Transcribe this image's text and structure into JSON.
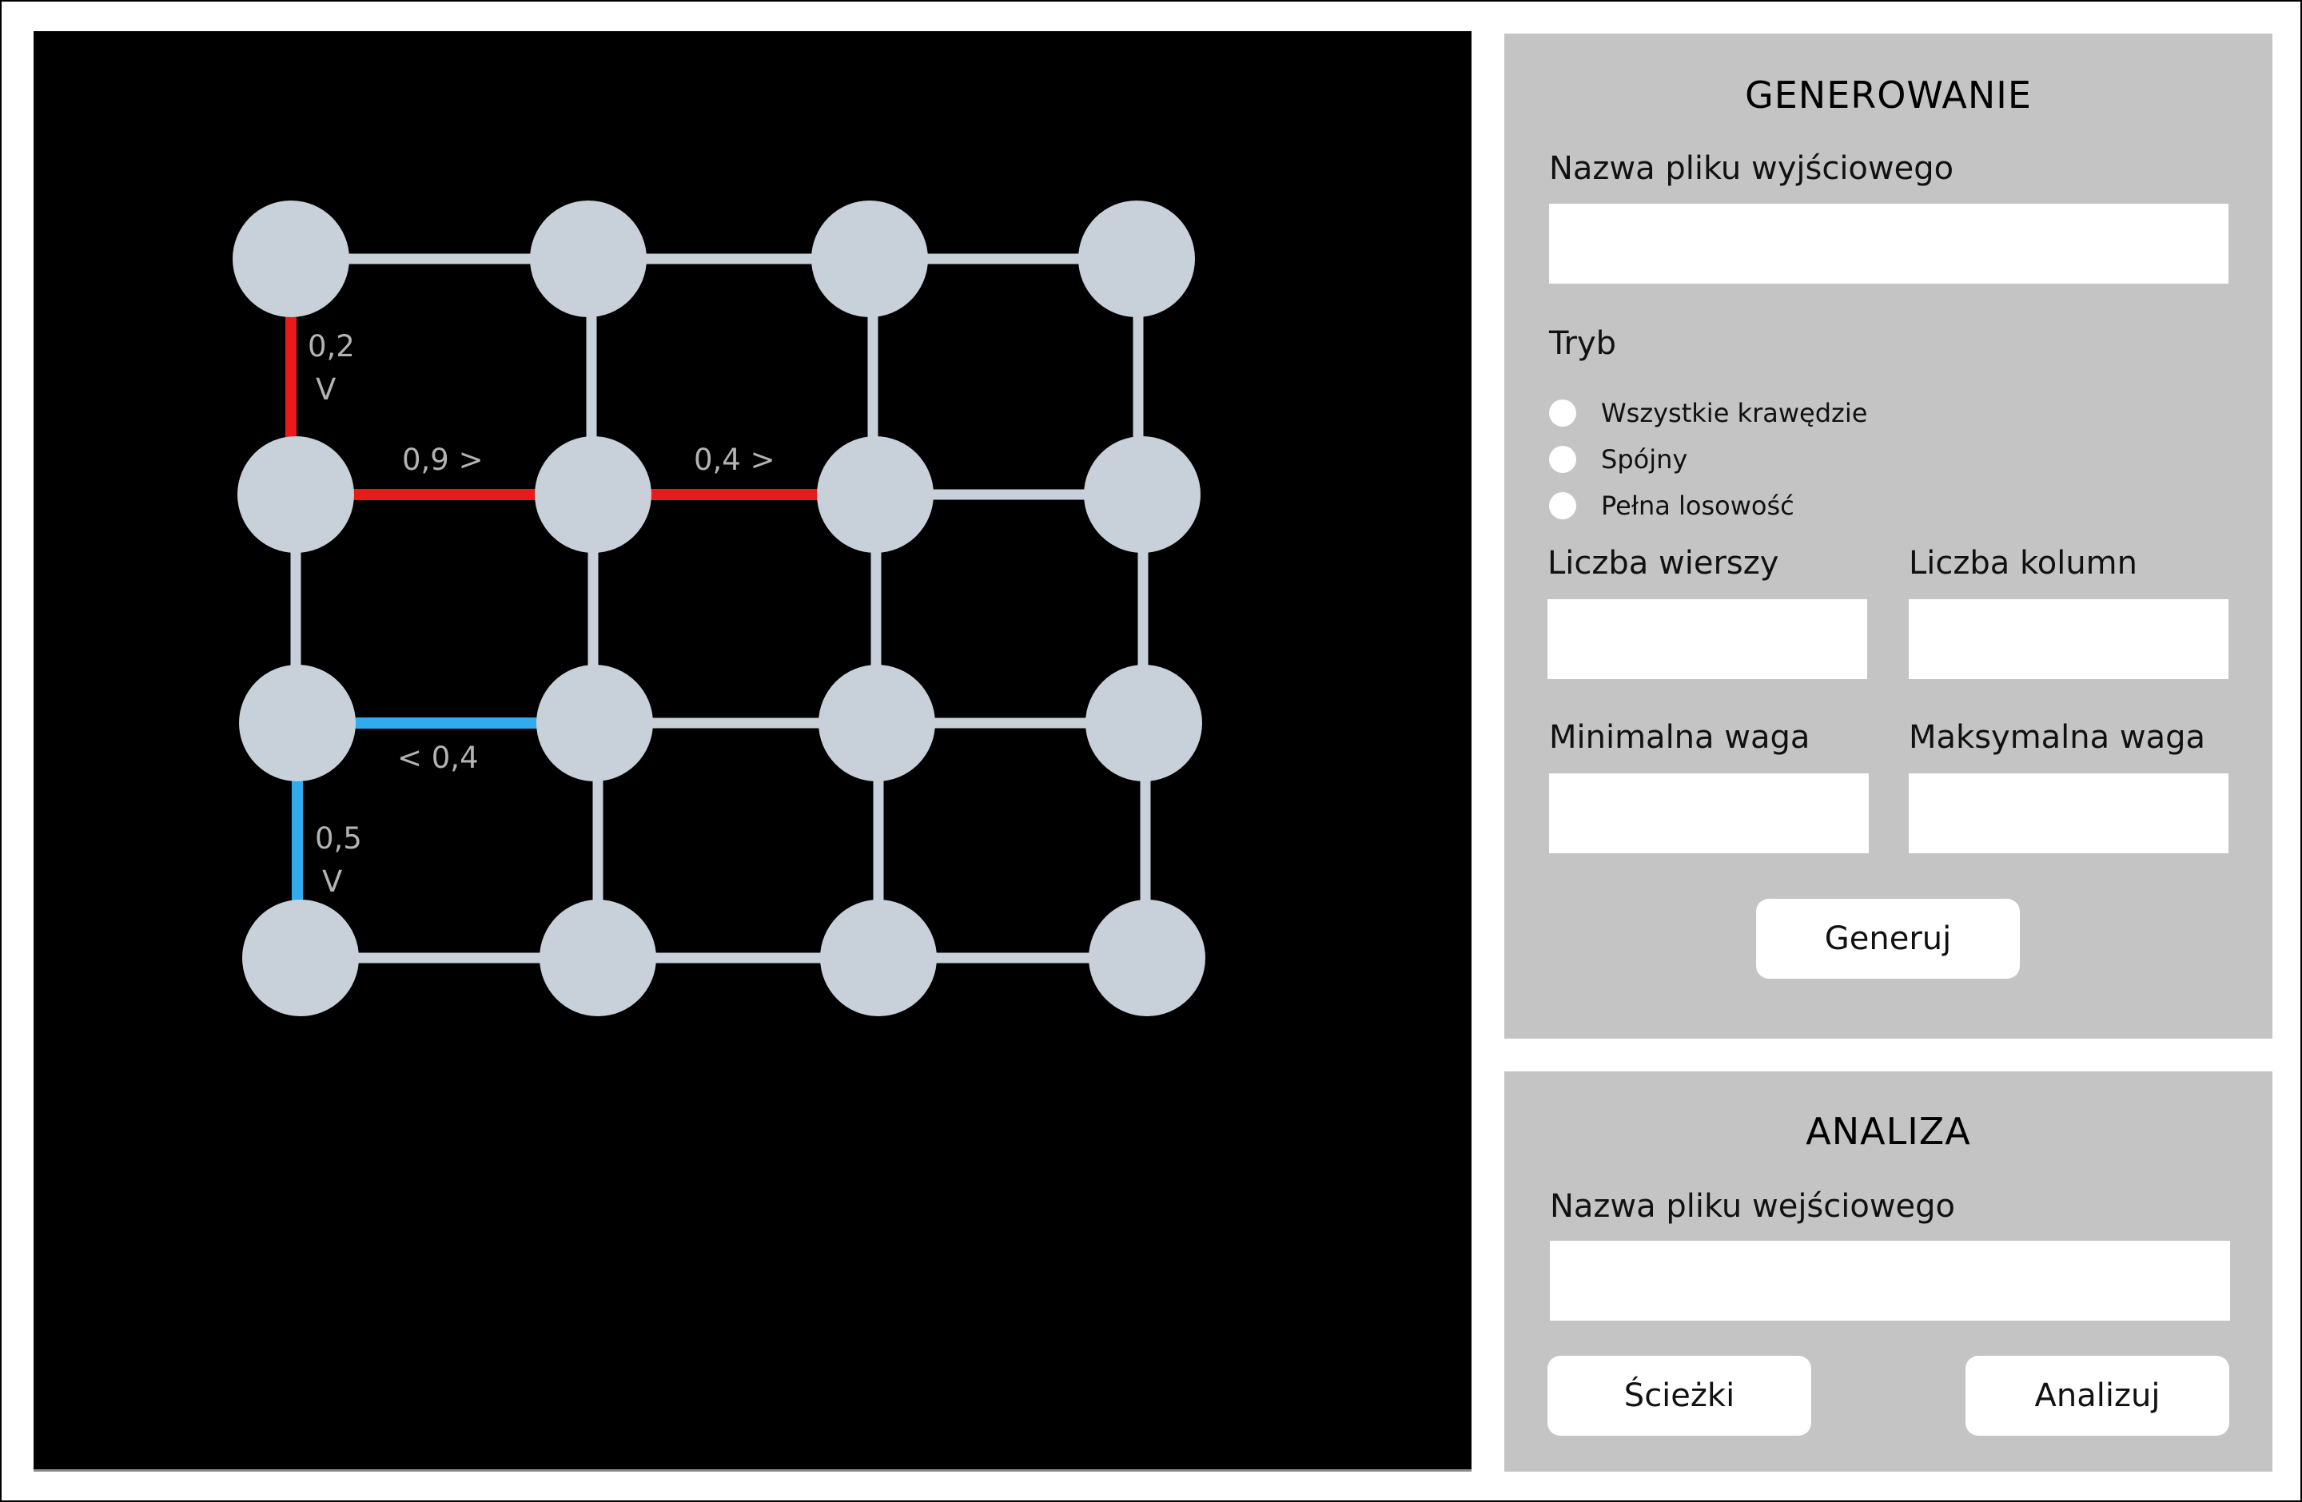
{
  "generate": {
    "title": "GENEROWANIE",
    "output_file_label": "Nazwa pliku wyjściowego",
    "output_file_value": "",
    "mode_label": "Tryb",
    "modes": [
      "Wszystkie krawędzie",
      "Spójny",
      "Pełna losowość"
    ],
    "rows_label": "Liczba wierszy",
    "rows_value": "",
    "cols_label": "Liczba kolumn",
    "cols_value": "",
    "min_weight_label": "Minimalna waga",
    "min_weight_value": "",
    "max_weight_label": "Maksymalna waga",
    "max_weight_value": "",
    "generate_button": "Generuj"
  },
  "analyze": {
    "title": "ANALIZA",
    "input_file_label": "Nazwa pliku wejściowego",
    "input_file_value": "",
    "paths_button": "Ścieżki",
    "analyze_button": "Analizuj"
  },
  "graph": {
    "rows": 4,
    "cols": 4,
    "colors": {
      "node": "#c8d0d9",
      "edge": "#c8d0d9",
      "red": "#ea1a1a",
      "blue": "#32aaee",
      "background": "#000000"
    },
    "weight_labels": {
      "r0c0_down": [
        "0,2",
        "V"
      ],
      "r1c0_right": "0,9 >",
      "r1c1_right": "0,4 >",
      "r2c0_right": "< 0,4",
      "r2c0_down": [
        "0,5",
        "V"
      ]
    }
  }
}
